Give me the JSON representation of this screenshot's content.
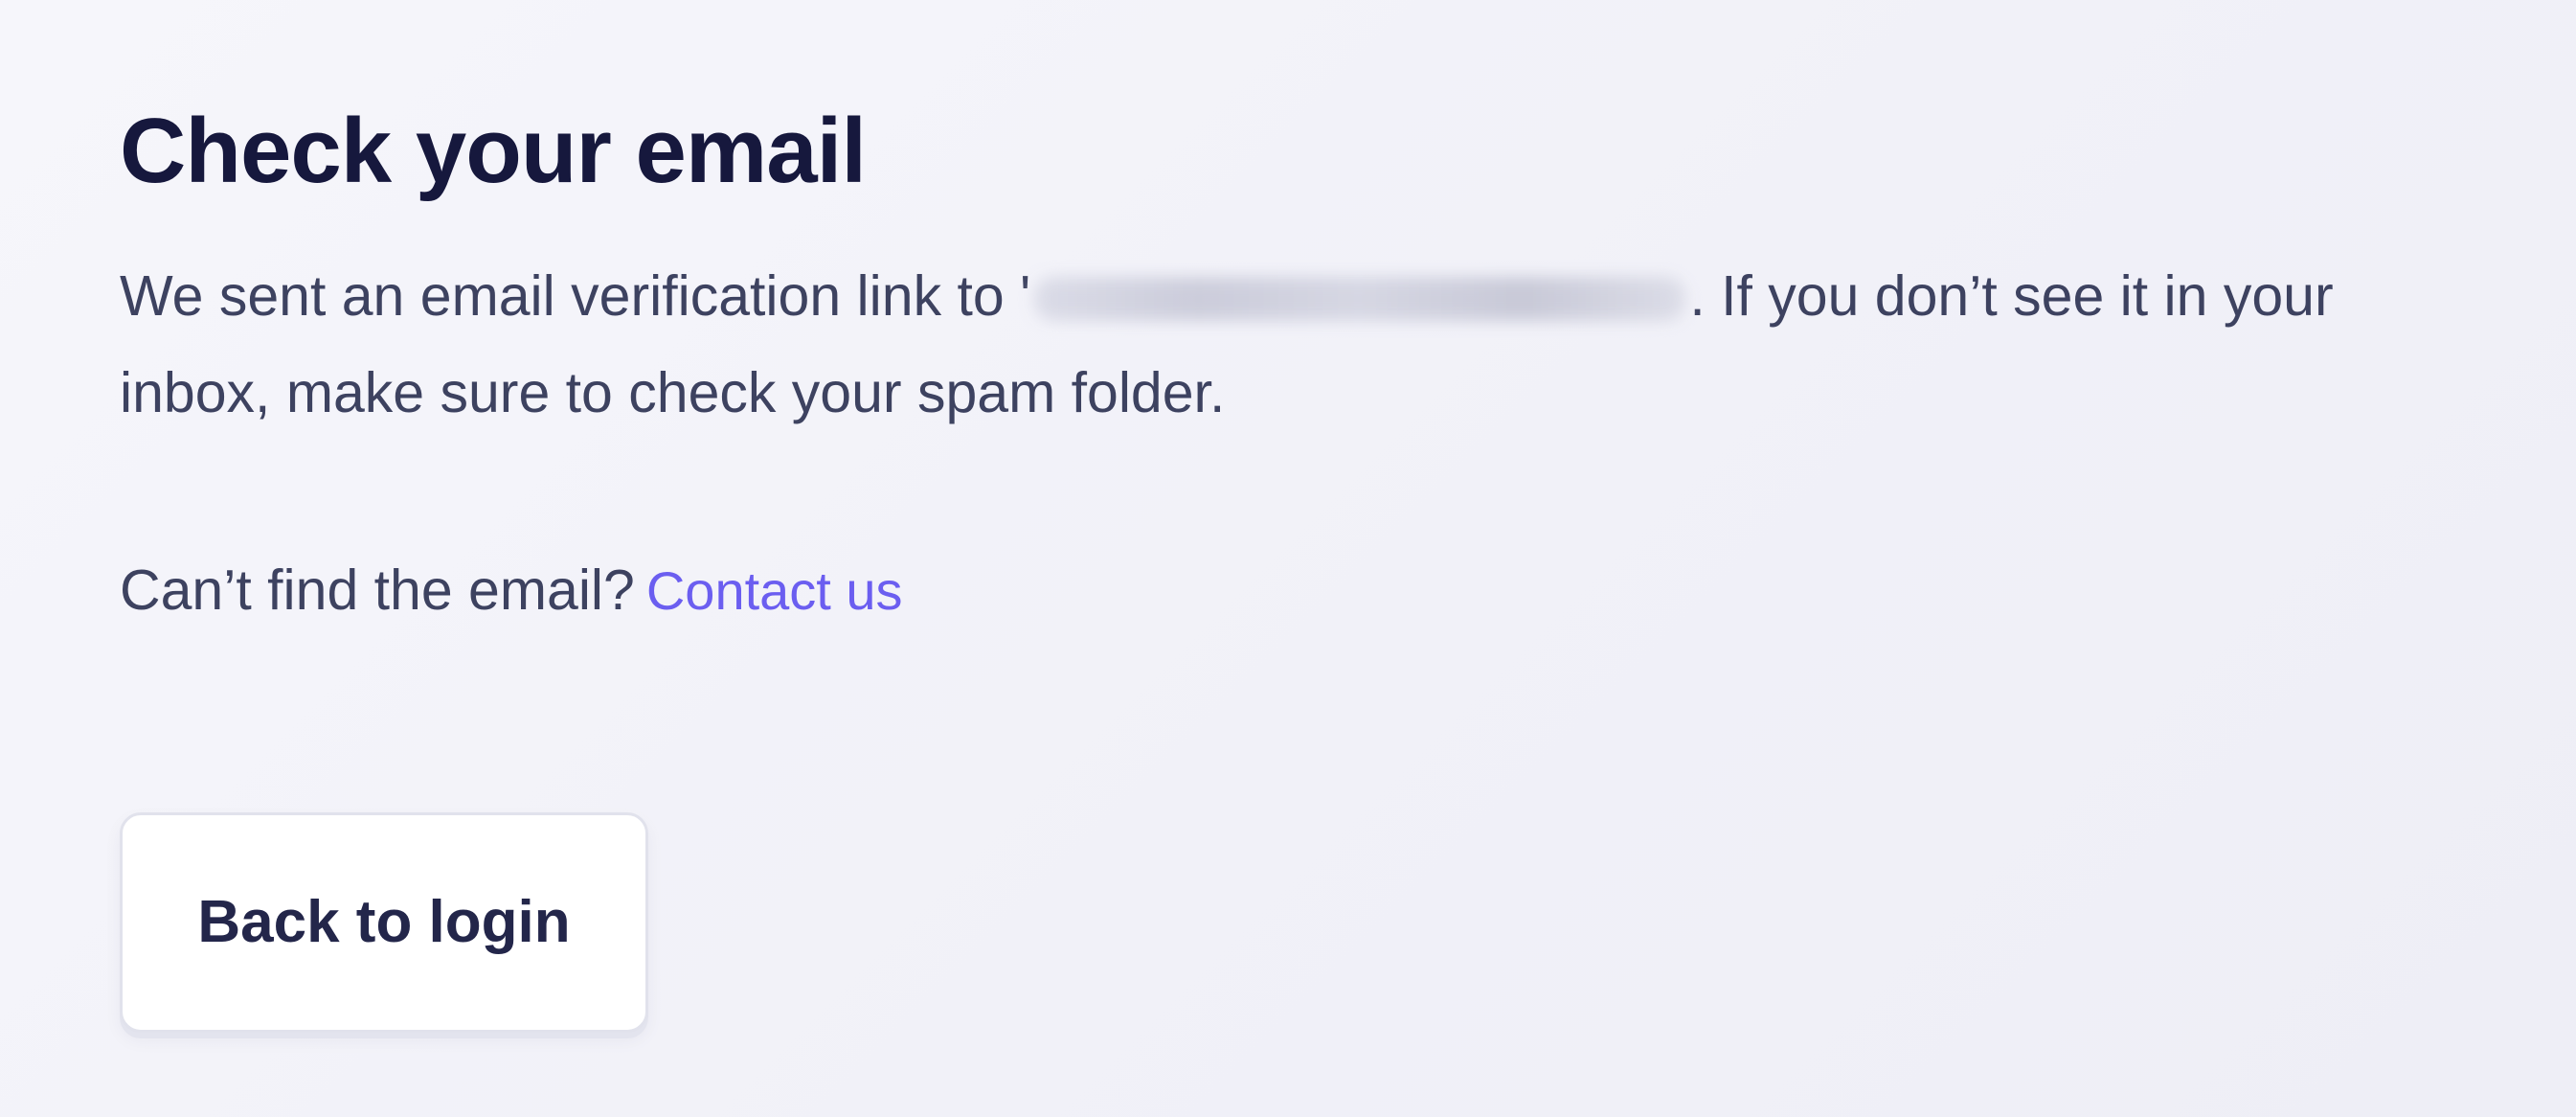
{
  "heading": {
    "title": "Check your email"
  },
  "message": {
    "prefix": "We sent an email verification link to '",
    "suffix": ". If you don’t see it in your inbox, make sure to check your spam folder."
  },
  "help": {
    "question": "Can’t find the email?",
    "contact_label": "Contact us"
  },
  "actions": {
    "back_label": "Back to login"
  },
  "colors": {
    "title": "#16183d",
    "body_text": "#3d4260",
    "link": "#6b5ef0",
    "button_bg": "#ffffff",
    "page_bg": "#f3f3f9"
  }
}
